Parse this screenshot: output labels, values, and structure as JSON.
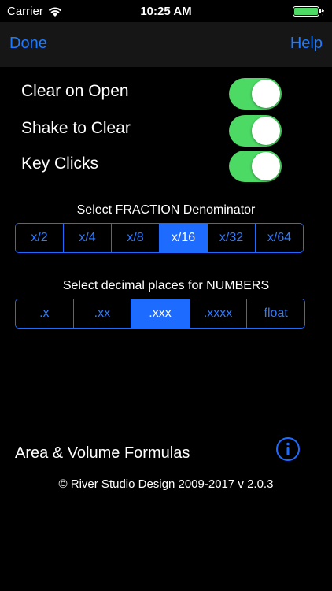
{
  "status_bar": {
    "carrier": "Carrier",
    "time": "10:25 AM"
  },
  "nav": {
    "done_label": "Done",
    "help_label": "Help"
  },
  "toggles": [
    {
      "label": "Clear on Open",
      "on": true
    },
    {
      "label": "Shake to Clear",
      "on": true
    },
    {
      "label": "Key Clicks",
      "on": true
    }
  ],
  "fraction": {
    "title": "Select FRACTION Denominator",
    "options": [
      "x/2",
      "x/4",
      "x/8",
      "x/16",
      "x/32",
      "x/64"
    ],
    "selected": "x/16"
  },
  "decimal": {
    "title": "Select decimal places for NUMBERS",
    "options": [
      ".x",
      ".xx",
      ".xxx",
      ".xxxx",
      "float"
    ],
    "selected": ".xxx"
  },
  "footer": {
    "formulas_label": "Area & Volume Formulas",
    "copyright": "© River Studio Design 2009-2017  v 2.0.3"
  },
  "colors": {
    "accent": "#1e6bff",
    "switch_on": "#4cd964",
    "background": "#000000"
  },
  "icons": {
    "wifi": "wifi-icon",
    "battery": "battery-icon",
    "info": "info-icon"
  }
}
